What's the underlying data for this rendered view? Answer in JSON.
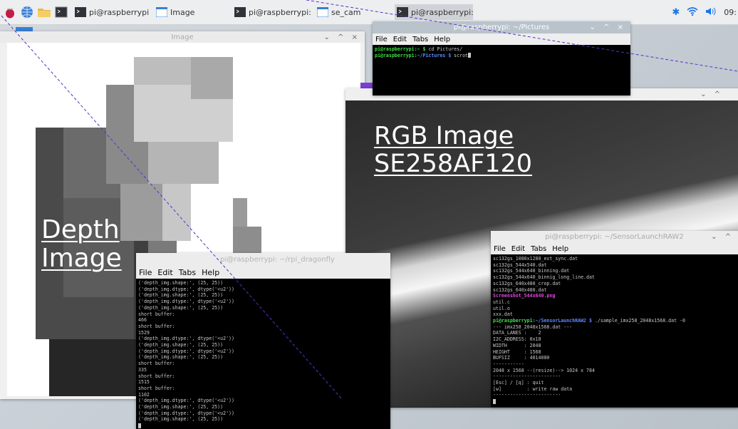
{
  "taskbar": {
    "tasks": [
      {
        "label": "pi@raspberrypi: ~/rpi..."
      },
      {
        "label": "Image"
      },
      {
        "label": "pi@raspberrypi: ~/Se..."
      },
      {
        "label": "se_cam"
      },
      {
        "label": "pi@raspberrypi: ~/Pic..."
      }
    ],
    "clock": "09:"
  },
  "image_window": {
    "title": "Image",
    "controls": "⌄ ^ ×",
    "overlay_line1": "Depth",
    "overlay_line2": "Image"
  },
  "pictures_terminal": {
    "title": "pi@raspberrypi: ~/Pictures",
    "controls": "⌄ ^ ×",
    "menu": [
      "File",
      "Edit",
      "Tabs",
      "Help"
    ],
    "line1_prompt": "pi@raspberrypi:~ $ ",
    "line1_cmd": "cd Pictures/",
    "line2_prompt_user": "pi@raspberrypi:",
    "line2_prompt_path": "~/Pictures $ ",
    "line2_cmd": "scrot"
  },
  "rgb_window": {
    "controls": "⌄ ^",
    "overlay_line1": "RGB  Image",
    "overlay_line2": "SE258AF120"
  },
  "dragon_terminal": {
    "title": "pi@raspberrypi: ~/rpi_dragonfly",
    "menu": [
      "File",
      "Edit",
      "Tabs",
      "Help"
    ],
    "lines": [
      "('depth_img.shape:', (25, 25))",
      "('depth_img.dtype:', dtype('<u2'))",
      "('depth_img.shape:', (25, 25))",
      "('depth_img.dtype:', dtype('<u2'))",
      "('depth_img.shape:', (25, 25))",
      "short buffer:",
      "466",
      "short buffer:",
      "1529",
      "('depth_img.dtype:', dtype('<u2'))",
      "('depth_img.shape:', (25, 25))",
      "('depth_img.dtype:', dtype('<u2'))",
      "('depth_img.shape:', (25, 25))",
      "short buffer:",
      "335",
      "short buffer:",
      "1515",
      "short buffer:",
      "1102",
      "('depth_img.dtype:', dtype('<u2'))",
      "('depth_img.shape:', (25, 25))",
      "('depth_img.dtype:', dtype('<u2'))",
      "('depth_img.shape:', (25, 25))"
    ]
  },
  "sensor_terminal": {
    "title": "pi@raspberrypi: ~/SensorLaunchRAW2",
    "controls": "⌄ ^",
    "menu": [
      "File",
      "Edit",
      "Tabs",
      "Help"
    ],
    "lines_top": [
      "sc132gs_1080x1280_ext_sync.dat",
      "sc132gs_544x540.dat",
      "sc132gs_544x640_binning.dat",
      "sc132gs_544x640_binnig_long_line.dat",
      "sc132gs_640x480_crop.dat",
      "sc132gs_640x480.dat"
    ],
    "screenshot_file": "Screenshot_544x640.png",
    "lines_mid": [
      "util.c",
      "util.o",
      "xxx.dat"
    ],
    "prompt_user": "pi@raspberrypi:",
    "prompt_path": "~/SensorLaunchRAW2 $ ",
    "command": "./sample_imx258_2048x1568.dat -0",
    "lines_out": [
      "--- imx258_2048x1568.dat ---",
      "DATA_LANES :    2",
      "I2C_ADDRESS: 0x10",
      "WIDTH      : 2048",
      "HEIGHT     : 1568",
      "BUFSIZ     : 4014080",
      "-----------",
      "2048 x 1568 --(resize)--> 1024 x 784",
      "------------------------",
      "[Esc] / [q] : quit",
      "[w]         : write raw data",
      "------------------------"
    ]
  },
  "depth_grid": [
    "WWWWWWWWWWWWWWWWWWWWWWWWW",
    "WWWWWWWWWWWWWWWWWWWWWWWWW",
    "WWWWWWWWWWWWWWWWWWWWWWWWW",
    "WWWWWWWWWWWWWWWWWWWWWWWWW",
    "WWWWWWWWWWWWWWWWWWWWWWWWW",
    "WWWWWWWWWWWWWWWWWWWWWWWWW",
    "WWWWWWWWWWWWWWWWWWWWWWWWW",
    "WWWWWWWWWWWWWWWWWWWWWWWWW",
    "WWWWWWWWWWWWWWWWWWWWWWWWW",
    "WWWWWWWWWWWWWWWWWWWWWWWWW",
    "WWWWWWWWWWWWWWWWWWWWWWWWW",
    "WWWWWWWWWWWWWWWWWWWWWWWWW",
    "WWWWWWWWWWWWWWWWWWWWWWWWW",
    "WWWWWWWWWWWWWWWWWWWWWWWWW",
    "WWWWWWWWWWWWWWWWWWWWWWWWW",
    "WWWWWWWWWWWWWWWWWWWWWWWWW",
    "WWWWWWWWWWWWWWWWWWWWWWWWW",
    "WWWWWWWWWWWWWWWWWWWWWWWWW",
    "WWWWWWWWWWWWWWWWWWWWWWWWW",
    "WWWWWWWWWWWWWWWWWWWWWWWWW",
    "WWWWWWWWWWWWWWWWWWWWWWWWW",
    "WWWWWWWWWWWWWWWWWWWWWWWWW",
    "WWWWWWWWWWWWWWWWWWWWWWWWW",
    "WWWWWWWWWWWWWWWWWWWWWWWWW",
    "WWWWWWWWWWWWWWWWWWWWWWWWW"
  ]
}
